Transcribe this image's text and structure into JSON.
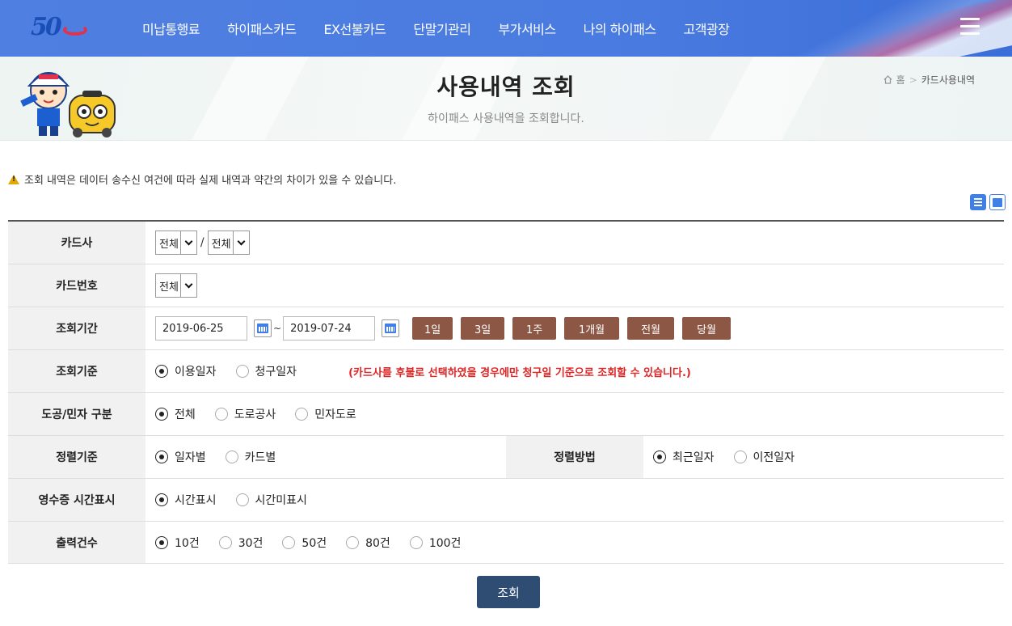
{
  "nav": {
    "logo_text": "50",
    "menu": [
      "미납통행료",
      "하이패스카드",
      "EX선불카드",
      "단말기관리",
      "부가서비스",
      "나의 하이패스",
      "고객광장"
    ]
  },
  "header": {
    "title": "사용내역 조회",
    "subtitle": "하이패스 사용내역을 조회합니다.",
    "breadcrumb": {
      "home": "홈",
      "sep": ">",
      "current": "카드사용내역"
    }
  },
  "notice": "조회 내역은 데이터 송수신 여건에 따라 실제 내역과 약간의 차이가 있을 수 있습니다.",
  "form": {
    "card_company": {
      "label": "카드사",
      "select1": "전체",
      "sep": "/",
      "select2": "전체"
    },
    "card_number": {
      "label": "카드번호",
      "select": "전체"
    },
    "period": {
      "label": "조회기간",
      "from": "2019-06-25",
      "tilde": "~",
      "to": "2019-07-24",
      "buttons": [
        "1일",
        "3일",
        "1주",
        "1개월",
        "전월",
        "당월"
      ]
    },
    "basis": {
      "label": "조회기준",
      "options": [
        "이용일자",
        "청구일자"
      ],
      "selected": 0,
      "note": "(카드사를 후불로 선택하였을 경우에만 청구일 기준으로 조회할 수 있습니다.)"
    },
    "road_type": {
      "label": "도공/민자 구분",
      "options": [
        "전체",
        "도로공사",
        "민자도로"
      ],
      "selected": 0
    },
    "sort_basis": {
      "label": "정렬기준",
      "options": [
        "일자별",
        "카드별"
      ],
      "selected": 0
    },
    "sort_order": {
      "label": "정렬방법",
      "options": [
        "최근일자",
        "이전일자"
      ],
      "selected": 0
    },
    "receipt_time": {
      "label": "영수증 시간표시",
      "options": [
        "시간표시",
        "시간미표시"
      ],
      "selected": 0
    },
    "output_count": {
      "label": "출력건수",
      "options": [
        "10건",
        "30건",
        "50건",
        "80건",
        "100건"
      ],
      "selected": 0
    }
  },
  "submit_label": "조회",
  "colors": {
    "nav": "#4f7fe0",
    "range_button": "#8d5746",
    "submit": "#2f4d72",
    "note": "#e02424"
  }
}
